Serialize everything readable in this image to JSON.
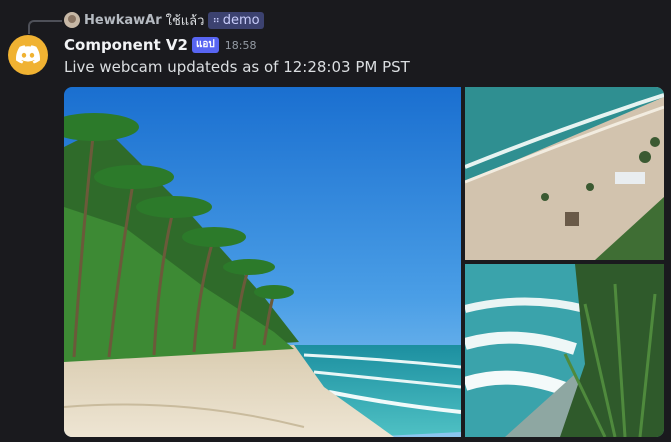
{
  "reply": {
    "username": "HewkawAr",
    "text": "ใช้แล้ว",
    "channel_chip": "demo"
  },
  "message": {
    "username": "Component V2",
    "app_tag": "แอป",
    "timestamp": "18:58",
    "content": "Live webcam updateds as of 12:28:03 PM PST"
  },
  "gallery": {
    "images": [
      {
        "name": "tropical-beach-palms"
      },
      {
        "name": "aerial-beach-shoreline"
      },
      {
        "name": "waves-and-foliage"
      }
    ]
  },
  "colors": {
    "background": "#1a1a1e",
    "avatar": "#f0b232",
    "app_tag": "#5865f2",
    "chip": "#3c4270"
  },
  "icons": {
    "avatar": "discord-logo-icon",
    "chip": "grid-dots-icon"
  }
}
